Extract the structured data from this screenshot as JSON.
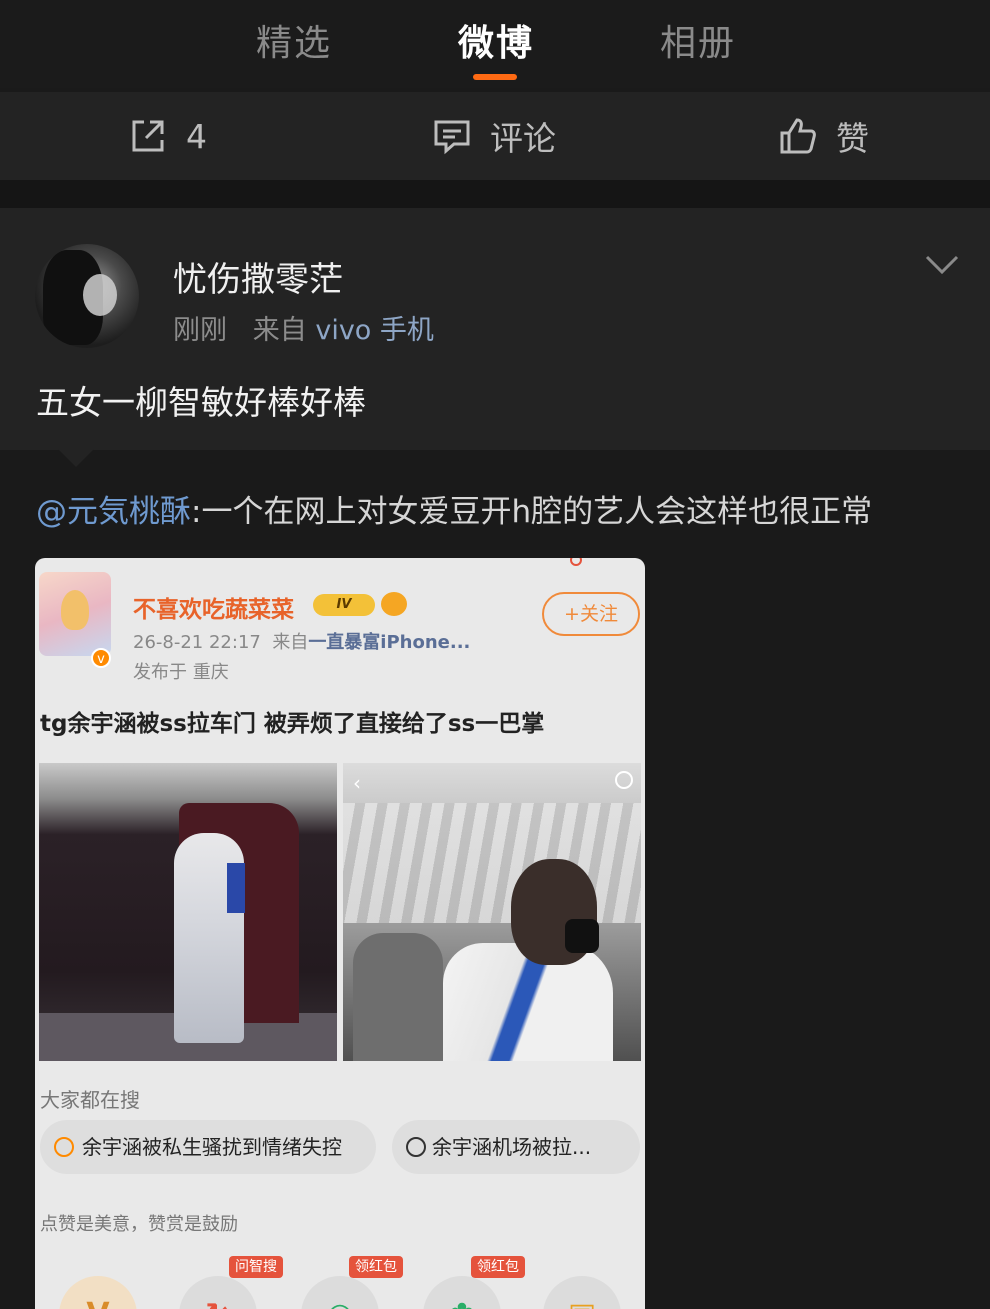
{
  "tabs": {
    "items": [
      {
        "label": "精选"
      },
      {
        "label": "微博"
      },
      {
        "label": "相册"
      }
    ],
    "active_index": 1,
    "accent": "#ff6a13"
  },
  "actions": {
    "repost": {
      "icon": "share-icon",
      "label": "4"
    },
    "comment": {
      "icon": "comment-icon",
      "label": "评论"
    },
    "like": {
      "icon": "thumbs-up-icon",
      "label": "赞"
    }
  },
  "post": {
    "username": "忧伤撒零茫",
    "time": "刚刚",
    "source_prefix": "来自",
    "device": "vivo 手机",
    "text": "五女一柳智敏好棒好棒"
  },
  "repost": {
    "mention": "@元気桃酥",
    "text": ":一个在网上对女爱豆开h腔的艺人会这样也很正常"
  },
  "embedded": {
    "name": "不喜欢吃蔬菜菜",
    "level_badge": "IV",
    "follow_label": "+关注",
    "time": "26-8-21 22:17",
    "source_prefix": "来自",
    "source": "一直暴富iPhone...",
    "location": "发布于 重庆",
    "title": "tg余宇涵被ss拉车门 被弄烦了直接给了ss一巴掌",
    "search_section": "大家都在搜",
    "search_pills": [
      {
        "label": "余宇涵被私生骚扰到情绪失控"
      },
      {
        "label": "余宇涵机场被拉..."
      }
    ],
    "reward_section": "点赞是美意，赞赏是鼓励",
    "bottom_tags": [
      "问智搜",
      "领红包",
      "领红包"
    ]
  }
}
